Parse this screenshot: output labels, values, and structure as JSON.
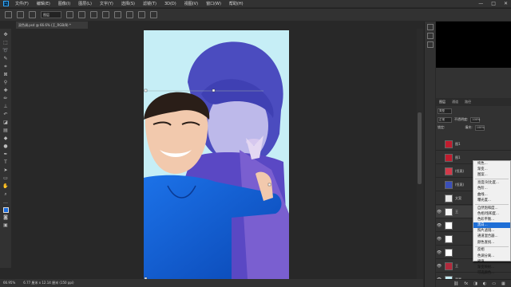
{
  "menubar": {
    "logo": "Ps",
    "items": [
      "文件(F)",
      "编辑(E)",
      "图像(I)",
      "图层(L)",
      "文字(Y)",
      "选择(S)",
      "滤镜(T)",
      "3D(D)",
      "视图(V)",
      "窗口(W)",
      "帮助(H)"
    ],
    "win": [
      "—",
      "□",
      "✕"
    ]
  },
  "options": {
    "mode": "图层"
  },
  "tab": {
    "label": "双色调.psd @ 66.6% (王_RGB/8) *"
  },
  "status": {
    "zoom": "66.95%",
    "doc": "6.77 厘米 x 12.14 厘米 (150 ppi)"
  },
  "layers": {
    "tabs": [
      "图层",
      "通道",
      "路径"
    ],
    "kind": "类型",
    "blend": "正常",
    "opacity_label": "不透明度:",
    "opacity": "100%",
    "lock_label": "锁定:",
    "fill_label": "填充:",
    "fill": "100%",
    "rows": [
      {
        "name": "图1",
        "eye": ""
      },
      {
        "name": "图1",
        "eye": ""
      },
      {
        "name": "(恒晃)",
        "eye": ""
      },
      {
        "name": "(恒晃)",
        "eye": ""
      },
      {
        "name": "文案",
        "eye": ""
      },
      {
        "name": "王",
        "eye": "👁"
      },
      {
        "name": "",
        "eye": "👁"
      },
      {
        "name": "",
        "eye": "👁"
      },
      {
        "name": "",
        "eye": "👁"
      },
      {
        "name": "王",
        "eye": "👁"
      },
      {
        "name": "背景",
        "eye": "👁"
      }
    ]
  },
  "context_menu": {
    "group1": [
      "纯色...",
      "渐变...",
      "图案..."
    ],
    "group2": [
      "亮度/对比度...",
      "色阶...",
      "曲线...",
      "曝光度..."
    ],
    "group3": [
      "自然饱和度...",
      "色相/饱和度...",
      "色彩平衡...",
      "黑白...",
      "照片滤镜...",
      "通道混合器...",
      "颜色查找..."
    ],
    "group4": [
      "反相",
      "色调分离...",
      "阈值...",
      "渐变映射...",
      "可选颜色..."
    ],
    "highlighted": "黑白..."
  },
  "panel_bottom": [
    "⛓",
    "fx",
    "◨",
    "◐",
    "▭",
    "▦",
    "🗑"
  ]
}
